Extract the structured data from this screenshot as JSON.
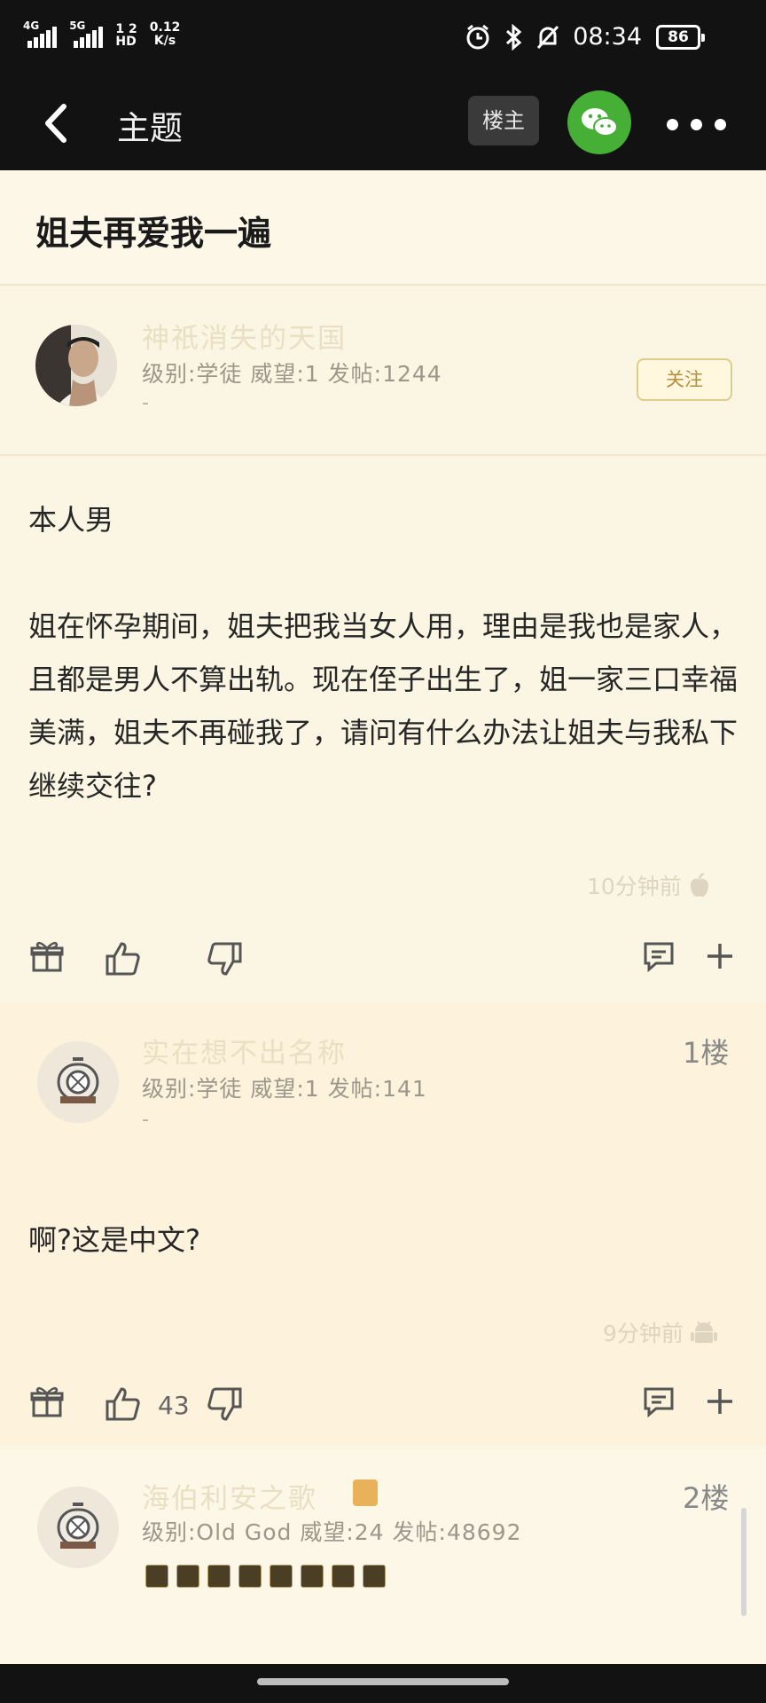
{
  "status": {
    "net1": "4G",
    "net2": "5G",
    "hd_top": "1 2",
    "hd_bottom": "HD",
    "speed_value": "0.12",
    "speed_unit": "K/s",
    "time": "08:34",
    "battery": "86"
  },
  "nav": {
    "title": "主题",
    "op_button": "楼主"
  },
  "post": {
    "title": "姐夫再爱我一遍",
    "author": "神祇消失的天国",
    "meta": "级别:学徒 威望:1 发帖:1244",
    "dash": "-",
    "follow": "关注",
    "paragraphs": [
      "本人男",
      "姐在怀孕期间，姐夫把我当女人用，理由是我也是家人，且都是男人不算出轨。现在侄子出生了，姐一家三口幸福美满，姐夫不再碰我了，请问有什么办法让姐夫与我私下继续交往?"
    ],
    "time": "10分钟前"
  },
  "replies": [
    {
      "author": "实在想不出名称",
      "meta": "级别:学徒 威望:1 发帖:141",
      "dash": "-",
      "floor": "1楼",
      "text": "啊?这是中文?",
      "time": "9分钟前",
      "likes": "43"
    },
    {
      "author": "海伯利安之歌",
      "meta": "级别:Old God 威望:24 发帖:48692",
      "floor": "2楼"
    }
  ],
  "icons": {
    "gift": "gift-icon",
    "like": "thumbs-up-icon",
    "dislike": "thumbs-down-icon",
    "comment": "comment-icon",
    "add": "plus-icon"
  },
  "colors": {
    "background": "#fbf6e3",
    "bar": "#121212",
    "wechat": "#45b035"
  }
}
